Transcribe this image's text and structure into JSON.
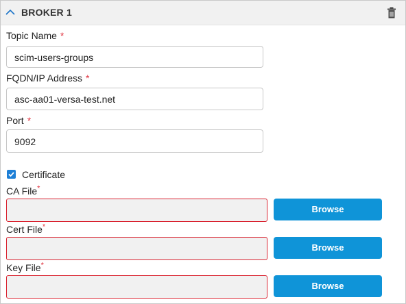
{
  "header": {
    "title": "BROKER 1",
    "collapse_icon": "chevron-up-icon",
    "delete_icon": "trash-icon"
  },
  "fields": {
    "topic": {
      "label": "Topic Name",
      "required_mark": "*",
      "value": "scim-users-groups"
    },
    "fqdn": {
      "label": "FQDN/IP Address",
      "required_mark": "*",
      "value": "asc-aa01-versa-test.net"
    },
    "port": {
      "label": "Port",
      "required_mark": "*",
      "value": "9092"
    }
  },
  "certificate": {
    "label": "Certificate",
    "checked": true
  },
  "files": {
    "ca": {
      "label": "CA File",
      "required_mark": "*",
      "value": "",
      "button": "Browse"
    },
    "cert": {
      "label": "Cert File",
      "required_mark": "*",
      "value": "",
      "button": "Browse"
    },
    "key": {
      "label": "Key File",
      "required_mark": "*",
      "value": "",
      "button": "Browse"
    }
  },
  "colors": {
    "accent": "#0f94d8",
    "required": "#e0333f",
    "error_border": "#d9222f",
    "checkbox": "#1d7fd6"
  }
}
